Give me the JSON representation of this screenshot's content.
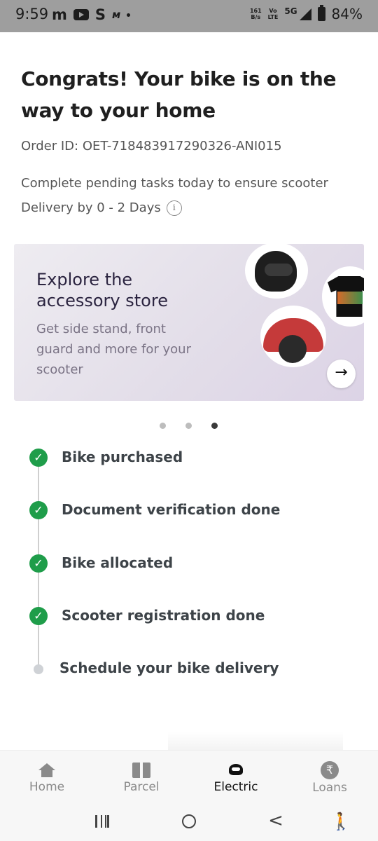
{
  "status_bar": {
    "time": "9:59",
    "app_icons": [
      "m",
      "youtube-icon",
      "S",
      "ᴍ"
    ],
    "net_speed_top": "161",
    "net_speed_bottom": "B/s",
    "volte_top": "Vo",
    "volte_bottom": "LTE",
    "network": "5G",
    "battery": "84%"
  },
  "header": {
    "title": "Congrats! Your bike is on the way to your home",
    "order_id": "Order ID: OET-718483917290326-ANI015",
    "pending_text": "Complete pending tasks today to ensure scooter Delivery by 0 - 2 Days",
    "info_icon": "i"
  },
  "banner": {
    "title": "Explore the accessory store",
    "subtitle": "Get side stand, front guard and more for your scooter",
    "arrow": "→",
    "products": [
      "helmet",
      "t-shirt",
      "front-guard"
    ]
  },
  "carousel": {
    "count": 3,
    "active_index": 2
  },
  "timeline": {
    "steps": [
      {
        "label": "Bike purchased",
        "done": true
      },
      {
        "label": "Document verification done",
        "done": true
      },
      {
        "label": "Bike allocated",
        "done": true
      },
      {
        "label": "Scooter registration done",
        "done": true
      },
      {
        "label": "Schedule your bike delivery",
        "done": false
      }
    ]
  },
  "bottom_nav": {
    "items": [
      {
        "label": "Home",
        "icon": "home-icon",
        "active": false
      },
      {
        "label": "Parcel",
        "icon": "parcel-icon",
        "active": false
      },
      {
        "label": "Electric",
        "icon": "electric-icon",
        "active": true
      },
      {
        "label": "Loans",
        "icon": "rupee-icon",
        "active": false
      }
    ],
    "loans_symbol": "₹"
  },
  "system_nav": {
    "back": "<",
    "accessibility": "🚶"
  },
  "colors": {
    "success": "#1f9d4a",
    "status_bar_bg": "#9e9e9e",
    "banner_bg": "#e3dee9"
  }
}
